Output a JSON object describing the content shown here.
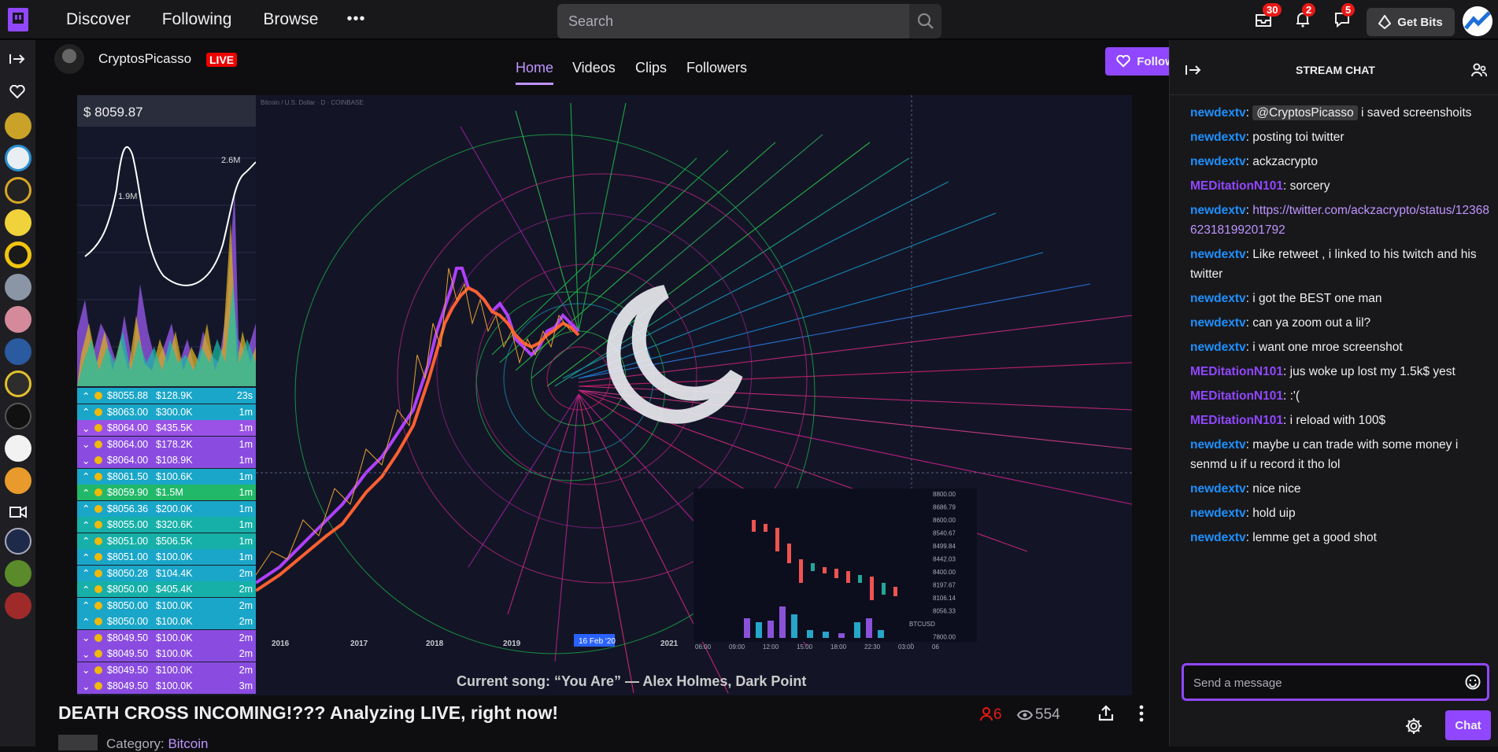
{
  "nav": {
    "discover": "Discover",
    "following": "Following",
    "browse": "Browse",
    "more": "•••"
  },
  "search": {
    "placeholder": "Search"
  },
  "badges": {
    "inbox": "30",
    "notifications": "2",
    "whispers": "5"
  },
  "get_bits": "Get Bits",
  "channel": {
    "name": "CryptosPicasso",
    "live": "LIVE",
    "tabs": [
      "Home",
      "Videos",
      "Clips",
      "Followers"
    ],
    "follow": "Follow"
  },
  "video": {
    "price": "$ 8059.87",
    "current_song": "Current song: “You Are” — Alex Holmes, Dark Point",
    "chart_title": "Bitcoin / U.S. Dollar · D · COINBASE",
    "year_labels": [
      "2016",
      "2017",
      "2018",
      "2019",
      "2021"
    ],
    "date_marker": "16 Feb '20",
    "mini_labels": [
      "8800.00",
      "8686.79",
      "8600.00",
      "8540.67",
      "8499.84",
      "8442.03",
      "8400.00",
      "8197.67",
      "8106.14",
      "8056.33",
      "BTCUSD",
      "7800.00"
    ],
    "mini_time": [
      "06:00",
      "09:00",
      "12:00",
      "15:00",
      "18:00",
      "22:30",
      "03:00",
      "06"
    ],
    "ticker_rows": [
      {
        "dir": "up",
        "price": "$8055.88",
        "amt": "$128.9K",
        "age": "23s",
        "color": "#1aa6c8"
      },
      {
        "dir": "up",
        "price": "$8063.00",
        "amt": "$300.0K",
        "age": "1m",
        "color": "#1aa6c8"
      },
      {
        "dir": "down",
        "price": "$8064.00",
        "amt": "$435.5K",
        "age": "1m",
        "color": "#9a52e6"
      },
      {
        "dir": "down",
        "price": "$8064.00",
        "amt": "$178.2K",
        "age": "1m",
        "color": "#8a4ce0"
      },
      {
        "dir": "down",
        "price": "$8064.00",
        "amt": "$108.9K",
        "age": "1m",
        "color": "#8a4ce0"
      },
      {
        "dir": "up",
        "price": "$8061.50",
        "amt": "$100.6K",
        "age": "1m",
        "color": "#1aa6c8"
      },
      {
        "dir": "up",
        "price": "$8059.90",
        "amt": "$1.5M",
        "age": "1m",
        "color": "#22b86a"
      },
      {
        "dir": "up",
        "price": "$8056.36",
        "amt": "$200.0K",
        "age": "1m",
        "color": "#1aa6c8"
      },
      {
        "dir": "up",
        "price": "$8055.00",
        "amt": "$320.6K",
        "age": "1m",
        "color": "#16b0a8"
      },
      {
        "dir": "up",
        "price": "$8051.00",
        "amt": "$506.5K",
        "age": "1m",
        "color": "#16b0a8"
      },
      {
        "dir": "up",
        "price": "$8051.00",
        "amt": "$100.0K",
        "age": "1m",
        "color": "#1aa6c8"
      },
      {
        "dir": "up",
        "price": "$8050.28",
        "amt": "$104.4K",
        "age": "2m",
        "color": "#1aa6c8"
      },
      {
        "dir": "up",
        "price": "$8050.00",
        "amt": "$405.4K",
        "age": "2m",
        "color": "#16b0a8"
      },
      {
        "dir": "up",
        "price": "$8050.00",
        "amt": "$100.0K",
        "age": "2m",
        "color": "#1aa6c8"
      },
      {
        "dir": "up",
        "price": "$8050.00",
        "amt": "$100.0K",
        "age": "2m",
        "color": "#1aa6c8"
      },
      {
        "dir": "down",
        "price": "$8049.50",
        "amt": "$100.0K",
        "age": "2m",
        "color": "#8a4ce0"
      },
      {
        "dir": "down",
        "price": "$8049.50",
        "amt": "$100.0K",
        "age": "2m",
        "color": "#8a4ce0"
      },
      {
        "dir": "down",
        "price": "$8049.50",
        "amt": "$100.0K",
        "age": "2m",
        "color": "#8a4ce0"
      },
      {
        "dir": "down",
        "price": "$8049.50",
        "amt": "$100.0K",
        "age": "3m",
        "color": "#8a4ce0"
      }
    ],
    "vol_labels": [
      "1.9M",
      "2.6M"
    ]
  },
  "stream": {
    "title": "DEATH CROSS INCOMING!??? Analyzing LIVE, right now!",
    "viewers": "6",
    "views": "554",
    "category_label": "Category:",
    "category": "Bitcoin"
  },
  "chat": {
    "title": "STREAM CHAT",
    "placeholder": "Send a message",
    "send": "Chat",
    "messages": [
      {
        "user": "newdextv",
        "color": "#1e90ff",
        "mention": "@CryptosPicasso",
        "text": "i saved screenshoits"
      },
      {
        "user": "newdextv",
        "color": "#1e90ff",
        "text": "posting toi twitter"
      },
      {
        "user": "newdextv",
        "color": "#1e90ff",
        "text": "ackzacrypto"
      },
      {
        "user": "MEDitationN101",
        "color": "#9147ff",
        "text": "sorcery"
      },
      {
        "user": "newdextv",
        "color": "#1e90ff",
        "link": "https://twitter.com/ackzacrypto/status/1236862318199201792"
      },
      {
        "user": "newdextv",
        "color": "#1e90ff",
        "text": "Like retweet , i linked to his twitch and his twitter"
      },
      {
        "user": "newdextv",
        "color": "#1e90ff",
        "text": "i got the BEST one man"
      },
      {
        "user": "newdextv",
        "color": "#1e90ff",
        "text": "can ya zoom out a lil?"
      },
      {
        "user": "newdextv",
        "color": "#1e90ff",
        "text": "i want one mroe screenshot"
      },
      {
        "user": "MEDitationN101",
        "color": "#9147ff",
        "text": "jus woke up lost my 1.5k$ yest"
      },
      {
        "user": "MEDitationN101",
        "color": "#9147ff",
        "text": ":'("
      },
      {
        "user": "MEDitationN101",
        "color": "#9147ff",
        "text": "i reload with 100$"
      },
      {
        "user": "newdextv",
        "color": "#1e90ff",
        "text": "maybe u can trade with some money i senmd u if u record it tho lol"
      },
      {
        "user": "newdextv",
        "color": "#1e90ff",
        "text": "nice nice"
      },
      {
        "user": "newdextv",
        "color": "#1e90ff",
        "text": "hold uip"
      },
      {
        "user": "newdextv",
        "color": "#1e90ff",
        "text": "lemme get a good shot"
      }
    ]
  }
}
